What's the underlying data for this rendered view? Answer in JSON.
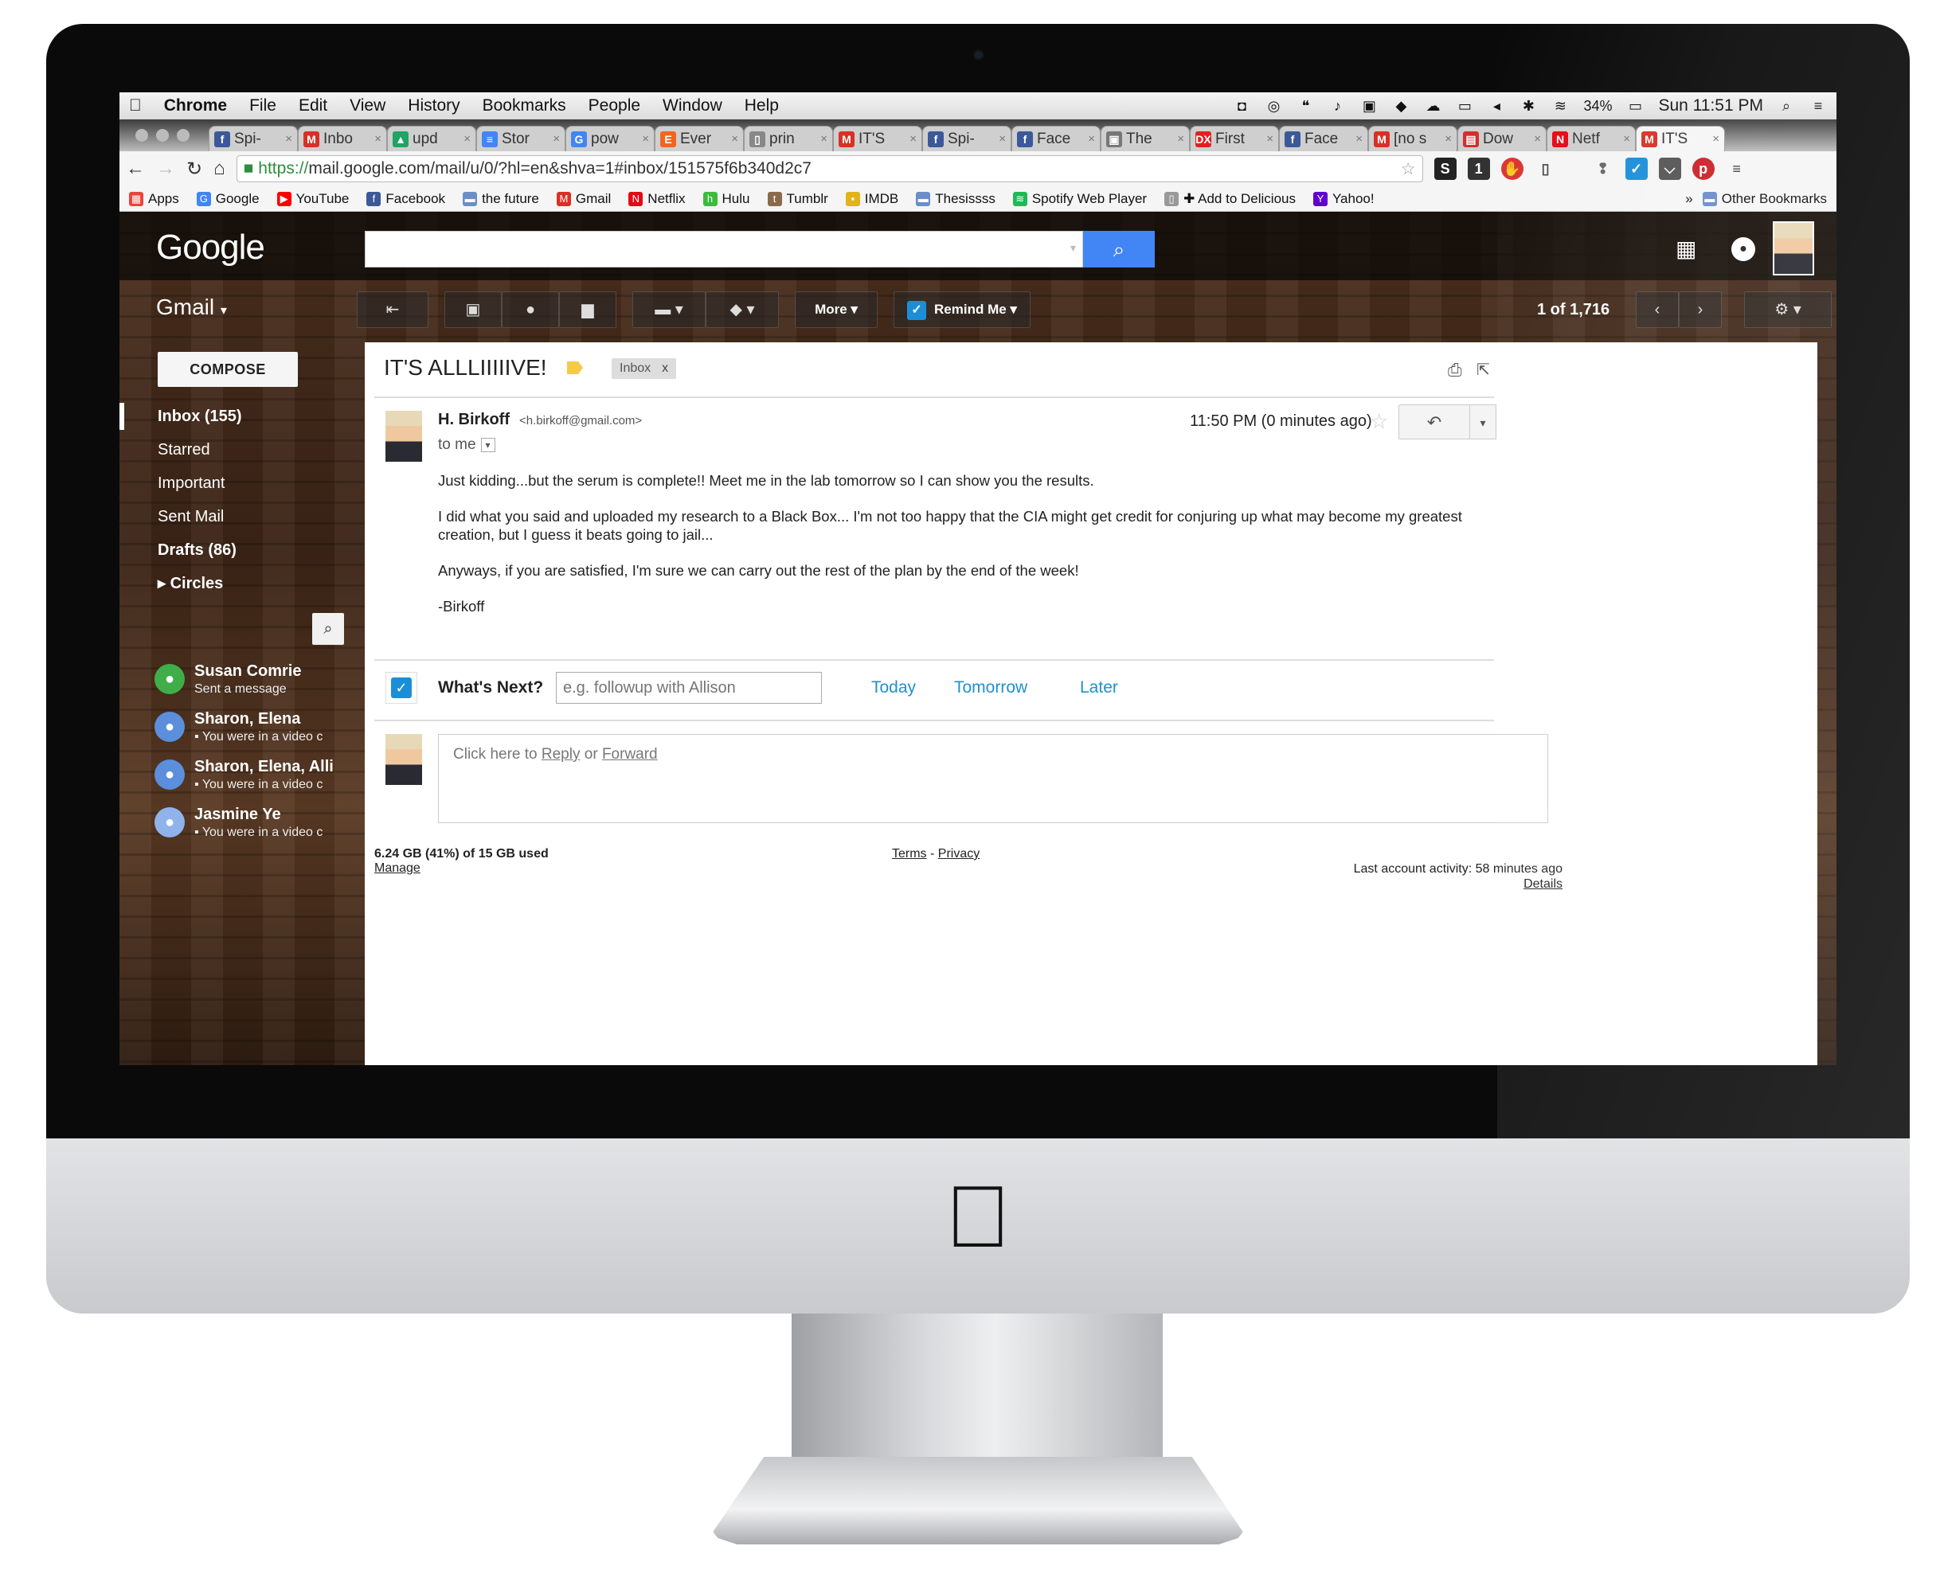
{
  "menubar": {
    "app": "Chrome",
    "menus": [
      "File",
      "Edit",
      "View",
      "History",
      "Bookmarks",
      "People",
      "Window",
      "Help"
    ],
    "battery": "34%",
    "clock": "Sun 11:51 PM"
  },
  "tabs": [
    {
      "label": "Spi-",
      "icon": "facebook-icon",
      "color": "#3b5998",
      "glyph": "f"
    },
    {
      "label": "Inbo",
      "icon": "gmail-icon",
      "color": "#d93025",
      "glyph": "M"
    },
    {
      "label": "upd",
      "icon": "drive-icon",
      "color": "#1fa463",
      "glyph": "▲"
    },
    {
      "label": "Stor",
      "icon": "docs-icon",
      "color": "#4285f4",
      "glyph": "≡"
    },
    {
      "label": "pow",
      "icon": "google-icon",
      "color": "#4285f4",
      "glyph": "G"
    },
    {
      "label": "Ever",
      "icon": "etsy-icon",
      "color": "#f16521",
      "glyph": "E"
    },
    {
      "label": "prin",
      "icon": "page-icon",
      "color": "#888888",
      "glyph": "▯"
    },
    {
      "label": "IT'S",
      "icon": "gmail-icon",
      "color": "#d93025",
      "glyph": "M"
    },
    {
      "label": "Spi-",
      "icon": "facebook-icon",
      "color": "#3b5998",
      "glyph": "f"
    },
    {
      "label": "Face",
      "icon": "facebook-icon",
      "color": "#3b5998",
      "glyph": "f"
    },
    {
      "label": "The",
      "icon": "image-icon",
      "color": "#777777",
      "glyph": "▣"
    },
    {
      "label": "First",
      "icon": "dx-icon",
      "color": "#e02020",
      "glyph": "DX"
    },
    {
      "label": "Face",
      "icon": "facebook-icon",
      "color": "#3b5998",
      "glyph": "f"
    },
    {
      "label": "[no s",
      "icon": "gmail-icon",
      "color": "#d93025",
      "glyph": "M"
    },
    {
      "label": "Dow",
      "icon": "pdf-icon",
      "color": "#d32f2f",
      "glyph": "▤"
    },
    {
      "label": "Netf",
      "icon": "netflix-icon",
      "color": "#e50914",
      "glyph": "N"
    },
    {
      "label": "IT'S",
      "icon": "gmail-icon",
      "color": "#d93025",
      "glyph": "M"
    }
  ],
  "omnibox": {
    "https": "https://",
    "url": "mail.google.com/mail/u/0/?hl=en&shva=1#inbox/151575f6b340d2c7"
  },
  "bookmarks": [
    {
      "label": "Apps",
      "color": "#e8453c",
      "glyph": "▦"
    },
    {
      "label": "Google",
      "color": "#4285f4",
      "glyph": "G"
    },
    {
      "label": "YouTube",
      "color": "#ff0000",
      "glyph": "▶"
    },
    {
      "label": "Facebook",
      "color": "#3b5998",
      "glyph": "f"
    },
    {
      "label": "the future",
      "color": "#6b8ec9",
      "glyph": "▬"
    },
    {
      "label": "Gmail",
      "color": "#d93025",
      "glyph": "M"
    },
    {
      "label": "Netflix",
      "color": "#e50914",
      "glyph": "N"
    },
    {
      "label": "Hulu",
      "color": "#3dbb3d",
      "glyph": "h"
    },
    {
      "label": "Tumblr",
      "color": "#8a6a4a",
      "glyph": "t"
    },
    {
      "label": "IMDB",
      "color": "#e0b41a",
      "glyph": "▪"
    },
    {
      "label": "Thesissss",
      "color": "#6b8ec9",
      "glyph": "▬"
    },
    {
      "label": "Spotify Web Player",
      "color": "#1db954",
      "glyph": "≋"
    },
    {
      "label": "✚ Add to Delicious",
      "color": "#999999",
      "glyph": "▯"
    },
    {
      "label": "Yahoo!",
      "color": "#5f01d1",
      "glyph": "Y"
    }
  ],
  "bookmarks_other": "Other Bookmarks",
  "gmail": {
    "logo": "Google",
    "product": "Gmail",
    "compose": "COMPOSE",
    "nav": [
      {
        "label": "Inbox (155)",
        "bold": true,
        "selected": true
      },
      {
        "label": "Starred"
      },
      {
        "label": "Important"
      },
      {
        "label": "Sent Mail"
      },
      {
        "label": "Drafts (86)",
        "bold": true
      },
      {
        "label": "▸ Circles",
        "bold": true
      }
    ],
    "contacts": [
      {
        "name": "Susan Comrie",
        "status": "Sent a message",
        "color": "#3fae49"
      },
      {
        "name": "Sharon, Elena",
        "status": "▪ You were in a video c",
        "color": "#5b8fdc"
      },
      {
        "name": "Sharon, Elena, Alli",
        "status": "▪ You were in a video c",
        "color": "#5b8fdc"
      },
      {
        "name": "Jasmine Ye",
        "status": "▪ You were in a video c",
        "color": "#8fb3ea"
      }
    ],
    "toolbar": {
      "more": "More ▾",
      "remind": "Remind Me ▾",
      "count": "1 of 1,716"
    },
    "subject": "IT'S ALLLIIIIIVE!",
    "inbox_chip": "Inbox",
    "inbox_chip_close": "x",
    "message": {
      "sender": "H. Birkoff",
      "email": "<h.birkoff@gmail.com>",
      "to": "to me",
      "time": "11:50 PM (0 minutes ago)",
      "body": [
        "Just kidding...but the serum is complete!! Meet me in the lab tomorrow so I can show you the results.",
        "I did what you said and uploaded my research to a Black Box... I'm not too happy that the CIA might get credit for conjuring up what may become my greatest creation, but I guess it beats going to jail...",
        "Anyways, if you are satisfied, I'm sure we can carry out the rest of the plan by the end of the week!",
        "-Birkoff"
      ]
    },
    "whats_next": {
      "label": "What's Next?",
      "placeholder": "e.g. followup with Allison",
      "today": "Today",
      "tomorrow": "Tomorrow",
      "later": "Later"
    },
    "reply": {
      "prefix": "Click here to",
      "reply": "Reply",
      "or": "or",
      "forward": "Forward"
    },
    "footer": {
      "storage": "6.24 GB (41%) of 15 GB used",
      "manage": "Manage",
      "terms": "Terms",
      "sep": "-",
      "privacy": "Privacy",
      "activity": "Last account activity: 58 minutes ago",
      "details": "Details"
    }
  }
}
